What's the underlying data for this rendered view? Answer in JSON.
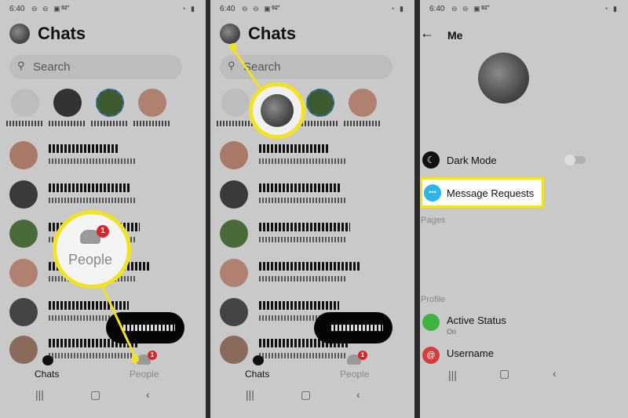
{
  "status": {
    "time": "6:40",
    "temp": "92°"
  },
  "chats": {
    "title": "Chats",
    "search_placeholder": "Search",
    "nav_chats": "Chats",
    "nav_people": "People",
    "people_badge": "1"
  },
  "callout1": {
    "label": "People",
    "badge": "1"
  },
  "me": {
    "title": "Me",
    "dark_mode": "Dark Mode",
    "dark_mode_on": false,
    "message_requests": "Message Requests",
    "pages": "Pages",
    "profile": "Profile",
    "active_status": "Active Status",
    "active_status_value": "On",
    "username": "Username"
  },
  "colors": {
    "highlight": "#f3e21f",
    "badge": "#d9262c",
    "messenger_blue": "#2bb5e8",
    "active_green": "#3fb33f",
    "username_red": "#d63a3a"
  },
  "icons": {
    "search": "search-icon",
    "people": "people-icon",
    "chat": "chat-bubble-icon",
    "back": "back-arrow-icon",
    "moon": "moon-icon"
  }
}
